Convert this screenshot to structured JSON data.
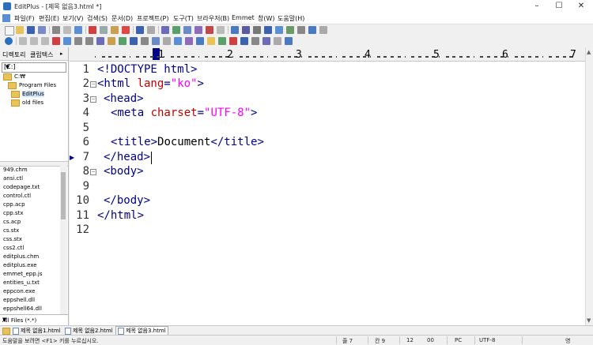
{
  "window": {
    "title": "EditPlus - [제목 없음3.html *]",
    "minimize": "–",
    "maximize": "☐",
    "close": "✕"
  },
  "menu": [
    "파일(F)",
    "편집(E)",
    "보기(V)",
    "검색(S)",
    "문서(D)",
    "프로젝트(P)",
    "도구(T)",
    "브라우저(B)",
    "Emmet",
    "창(W)",
    "도움말(H)"
  ],
  "sidebar": {
    "tab_directory": "디렉토리",
    "tab_cliptext": "클립텍스",
    "drive": "[C:]",
    "tree": [
      "C:₩",
      "Program Files",
      "EditPlus",
      "old files"
    ],
    "files": [
      "949.chm",
      "ansi.ctl",
      "codepage.txt",
      "control.ctl",
      "cpp.acp",
      "cpp.stx",
      "cs.acp",
      "cs.stx",
      "css.stx",
      "css2.ctl",
      "editplus.chm",
      "editplus.exe",
      "emmet_epp.js",
      "entities_u.txt",
      "eppcon.exe",
      "eppshell.dll",
      "eppshell64.dll"
    ],
    "filter": "All Files (*.*)"
  },
  "ruler": {
    "marks": [
      "1",
      "2",
      "3",
      "4",
      "5",
      "6",
      "7"
    ]
  },
  "editor": {
    "line_numbers": [
      "1",
      "2",
      "3",
      "4",
      "5",
      "6",
      "7",
      "8",
      "9",
      "10",
      "11",
      "12"
    ],
    "lines": {
      "l1_a": "<!DOCTYPE html>",
      "l2_a": "<html ",
      "l2_b": "lang",
      "l2_c": "=",
      "l2_d": "\"ko\"",
      "l2_e": ">",
      "l3_a": "<head>",
      "l4_a": "<meta ",
      "l4_b": "charset",
      "l4_c": "=",
      "l4_d": "\"UTF-8\"",
      "l4_e": ">",
      "l6_a": "<title>",
      "l6_b": "Document",
      "l6_c": "</title>",
      "l7_a": "</head>",
      "l8_a": "<body>",
      "l10_a": "</body>",
      "l11_a": "</html>"
    }
  },
  "doc_tabs": [
    "제목 없음1.html",
    "제목 없음2.html",
    "제목 없음3.html"
  ],
  "status": {
    "help": "도움말을 보려면 <F1> 키를 누르십시오.",
    "line": "줄 7",
    "col": "칸 9",
    "num": "12",
    "num2": "00",
    "pc": "PC",
    "encoding": "UTF-8",
    "ime": "영"
  },
  "colors": {
    "tag": "#00008b",
    "attribute": "#c00000",
    "value": "#ff00ff"
  }
}
